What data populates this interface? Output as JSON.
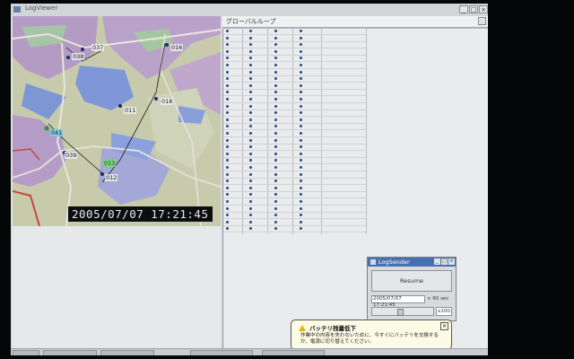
{
  "window": {
    "title": "LogViewer",
    "controls": {
      "minimize": "_",
      "maximize": "□",
      "close": "×"
    }
  },
  "map": {
    "timestamp": "2005/07/07 17:21:45",
    "points": [
      {
        "label": "037",
        "style": "plain"
      },
      {
        "label": "038",
        "style": "plain"
      },
      {
        "label": "016",
        "style": "plain"
      },
      {
        "label": "011",
        "style": "plain"
      },
      {
        "label": "018",
        "style": "plain"
      },
      {
        "label": "039",
        "style": "plain"
      },
      {
        "label": "012",
        "style": "plain"
      },
      {
        "label": "041",
        "style": "cyan"
      },
      {
        "label": "013",
        "style": "green"
      }
    ]
  },
  "list": {
    "group_label": "グローバルループ"
  },
  "logsender": {
    "title": "LogSender",
    "controls": {
      "minimize": "_",
      "maximize": "□",
      "close": "×"
    },
    "resume_label": "Resume",
    "datetime": "2005/07/07 17:21:45",
    "interval": "× 60 sec",
    "multiplier": "x100"
  },
  "balloon": {
    "title": "バッテリ残量低下",
    "body": "作業中の内容を失わないために、今すぐにバッテリを交換するか、電源に切り替えてください。",
    "close": "×"
  },
  "colors": {
    "titlebar_blue": "#4670b4",
    "status_green": "#3ba85a",
    "status_dark": "#1c2a2a"
  }
}
